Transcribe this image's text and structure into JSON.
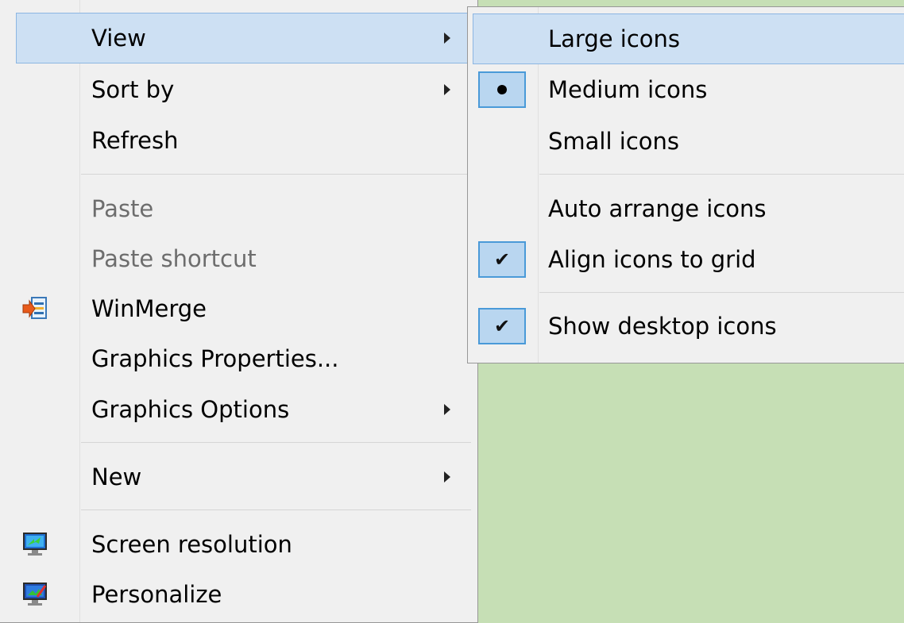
{
  "main_menu": {
    "items": [
      {
        "label": "View",
        "submenu": true,
        "selected": true
      },
      {
        "label": "Sort by",
        "submenu": true
      },
      {
        "label": "Refresh"
      },
      {
        "label": "Paste",
        "disabled": true
      },
      {
        "label": "Paste shortcut",
        "disabled": true
      },
      {
        "label": "WinMerge",
        "icon": "winmerge-icon"
      },
      {
        "label": "Graphics Properties..."
      },
      {
        "label": "Graphics Options",
        "submenu": true
      },
      {
        "label": "New",
        "submenu": true
      },
      {
        "label": "Screen resolution",
        "icon": "screen-resolution-icon"
      },
      {
        "label": "Personalize",
        "icon": "personalize-icon"
      }
    ]
  },
  "view_submenu": {
    "items": [
      {
        "label": "Large icons",
        "selected": true
      },
      {
        "label": "Medium icons",
        "mark": "radio-dot"
      },
      {
        "label": "Small icons"
      },
      {
        "label": "Auto arrange icons"
      },
      {
        "label": "Align icons to grid",
        "mark": "checkmark"
      },
      {
        "label": "Show desktop icons",
        "mark": "checkmark"
      }
    ]
  },
  "colors": {
    "desktop_bg": "#c6dfb5",
    "menu_bg": "#f0f0f0",
    "highlight_bg": "#cde0f3",
    "highlight_border": "#8cb6e2",
    "disabled_text": "#6d6d6d"
  }
}
